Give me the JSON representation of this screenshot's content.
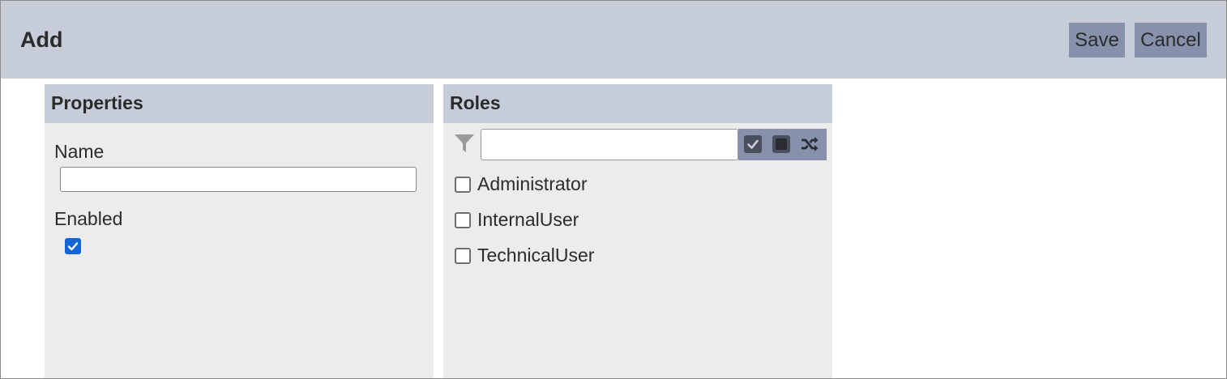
{
  "dialog": {
    "title": "Add",
    "save_label": "Save",
    "cancel_label": "Cancel"
  },
  "properties": {
    "heading": "Properties",
    "name_label": "Name",
    "name_value": "",
    "enabled_label": "Enabled",
    "enabled_checked": true
  },
  "roles": {
    "heading": "Roles",
    "filter_value": "",
    "tools": [
      "filter-icon",
      "select-all-icon",
      "select-none-icon",
      "shuffle-icon"
    ],
    "items": [
      {
        "label": "Administrator",
        "checked": false
      },
      {
        "label": "InternalUser",
        "checked": false
      },
      {
        "label": "TechnicalUser",
        "checked": false
      }
    ]
  },
  "colors": {
    "header_bg": "#c6cdd9",
    "button_bg": "#8791ab",
    "panel_bg": "#ececec",
    "checkbox_accent": "#1266d6"
  }
}
